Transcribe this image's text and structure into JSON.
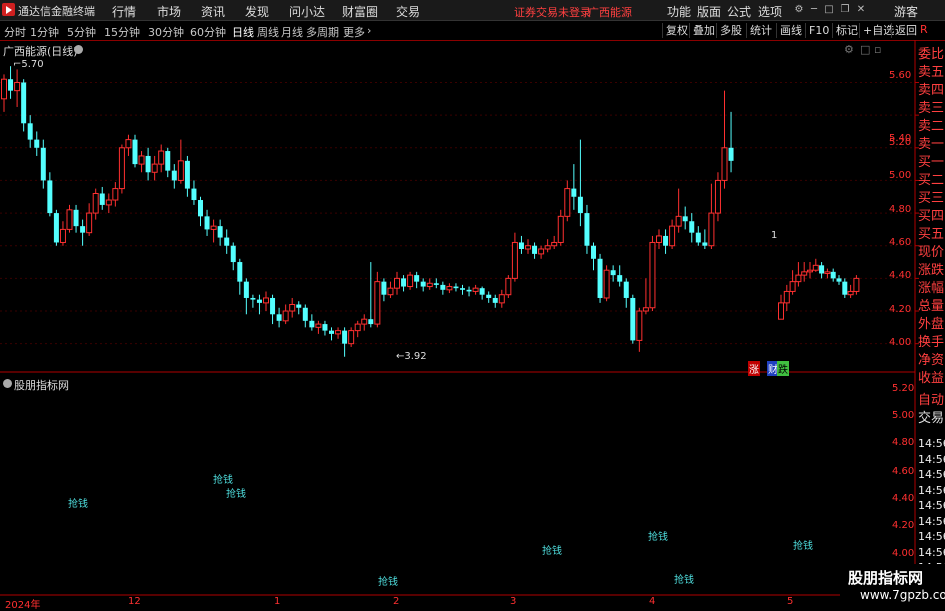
{
  "app": {
    "title": "通达信金融终端"
  },
  "menu": [
    "行情",
    "市场",
    "资讯",
    "发现",
    "问小达",
    "财富圈",
    "交易"
  ],
  "warning": "证券交易未登录",
  "stock_tag": "广西能源",
  "right_menu": [
    "功能",
    "版面",
    "公式",
    "选项"
  ],
  "guest": "游客",
  "periods": [
    "分时",
    "1分钟",
    "5分钟",
    "15分钟",
    "30分钟",
    "60分钟",
    "日线",
    "周线",
    "月线",
    "多周期",
    "更多"
  ],
  "active_period": "日线",
  "tools": [
    "复权",
    "叠加",
    "多股",
    "统计",
    "画线",
    "F10",
    "标记",
    "+自选",
    "返回"
  ],
  "r_badge": "R",
  "chart_header": {
    "name": "广西能源(日线)"
  },
  "price_axis": [
    "5.60",
    "5.40",
    "5.20",
    "5.00",
    "4.80",
    "4.60",
    "4.40",
    "4.20",
    "4.00"
  ],
  "sub_axis": [
    "5.20",
    "5.00",
    "4.80",
    "4.60",
    "4.40",
    "4.20",
    "4.00"
  ],
  "high_label": "5.70",
  "low_label": "3.92",
  "right_panel": [
    "委比",
    "卖五",
    "卖四",
    "卖三",
    "卖二",
    "卖一",
    "买一",
    "买二",
    "买三",
    "买四",
    "买五",
    "现价",
    "涨跌",
    "涨幅",
    "总量",
    "外盘",
    "换手",
    "净资",
    "收益"
  ],
  "right_panel_bottom": [
    "自动",
    "交易"
  ],
  "times": [
    "14:56",
    "14:56",
    "14:56",
    "14:56",
    "14:56",
    "14:56",
    "14:56",
    "14:56",
    "14:56",
    "14:56"
  ],
  "indicator": {
    "name": "股朋指标网",
    "signal_label": "抢钱"
  },
  "x_axis_labels": [
    "2024年",
    "12",
    "1",
    "2",
    "3",
    "4",
    "5"
  ],
  "badges": {
    "zhang": "涨",
    "cai": "财",
    "die": "跌"
  },
  "marker_one": "1",
  "watermark": {
    "line1": "股朋指标网",
    "line2": "www.7gpzb.com"
  },
  "colors": {
    "up": "#ff3030",
    "down": "#54ffff",
    "background": "#000000"
  },
  "chart_data": {
    "type": "candlestick",
    "ylim": [
      3.9,
      5.75
    ],
    "candles": [
      [
        5.5,
        5.62,
        5.42,
        5.65
      ],
      [
        5.62,
        5.55,
        5.5,
        5.7
      ],
      [
        5.55,
        5.6,
        5.45,
        5.68
      ],
      [
        5.6,
        5.35,
        5.3,
        5.62
      ],
      [
        5.35,
        5.25,
        5.2,
        5.4
      ],
      [
        5.25,
        5.2,
        5.15,
        5.3
      ],
      [
        5.2,
        5.0,
        4.95,
        5.25
      ],
      [
        5.0,
        4.8,
        4.78,
        5.05
      ],
      [
        4.8,
        4.62,
        4.6,
        4.82
      ],
      [
        4.62,
        4.7,
        4.6,
        4.75
      ],
      [
        4.7,
        4.82,
        4.68,
        4.85
      ],
      [
        4.82,
        4.72,
        4.68,
        4.85
      ],
      [
        4.72,
        4.68,
        4.6,
        4.76
      ],
      [
        4.68,
        4.8,
        4.66,
        4.86
      ],
      [
        4.8,
        4.92,
        4.76,
        4.95
      ],
      [
        4.92,
        4.85,
        4.82,
        4.96
      ],
      [
        4.85,
        4.88,
        4.8,
        4.92
      ],
      [
        4.88,
        4.95,
        4.84,
        4.99
      ],
      [
        4.95,
        5.2,
        4.92,
        5.22
      ],
      [
        5.2,
        5.25,
        5.15,
        5.28
      ],
      [
        5.25,
        5.1,
        5.08,
        5.28
      ],
      [
        5.1,
        5.15,
        5.05,
        5.18
      ],
      [
        5.15,
        5.05,
        5.0,
        5.2
      ],
      [
        5.05,
        5.1,
        5.0,
        5.15
      ],
      [
        5.1,
        5.18,
        5.05,
        5.22
      ],
      [
        5.18,
        5.06,
        5.02,
        5.2
      ],
      [
        5.06,
        5.0,
        4.95,
        5.1
      ],
      [
        5.0,
        5.12,
        4.98,
        5.25
      ],
      [
        5.12,
        4.95,
        4.9,
        5.15
      ],
      [
        4.95,
        4.88,
        4.85,
        5.0
      ],
      [
        4.88,
        4.78,
        4.72,
        4.9
      ],
      [
        4.78,
        4.7,
        4.66,
        4.82
      ],
      [
        4.7,
        4.72,
        4.62,
        4.76
      ],
      [
        4.72,
        4.65,
        4.6,
        4.76
      ],
      [
        4.65,
        4.6,
        4.55,
        4.7
      ],
      [
        4.6,
        4.5,
        4.45,
        4.62
      ],
      [
        4.5,
        4.38,
        4.3,
        4.52
      ],
      [
        4.38,
        4.28,
        4.18,
        4.4
      ],
      [
        4.28,
        4.27,
        4.22,
        4.3
      ],
      [
        4.27,
        4.25,
        4.18,
        4.3
      ],
      [
        4.25,
        4.28,
        4.2,
        4.32
      ],
      [
        4.28,
        4.18,
        4.12,
        4.3
      ],
      [
        4.18,
        4.14,
        4.1,
        4.22
      ],
      [
        4.14,
        4.2,
        4.12,
        4.24
      ],
      [
        4.2,
        4.24,
        4.16,
        4.28
      ],
      [
        4.24,
        4.22,
        4.18,
        4.26
      ],
      [
        4.22,
        4.14,
        4.1,
        4.24
      ],
      [
        4.14,
        4.1,
        4.08,
        4.18
      ],
      [
        4.1,
        4.12,
        4.06,
        4.14
      ],
      [
        4.12,
        4.08,
        4.05,
        4.14
      ],
      [
        4.08,
        4.06,
        4.02,
        4.1
      ],
      [
        4.06,
        4.08,
        4.03,
        4.1
      ],
      [
        4.08,
        4.0,
        3.92,
        4.1
      ],
      [
        4.0,
        4.08,
        3.98,
        4.1
      ],
      [
        4.08,
        4.12,
        4.04,
        4.14
      ],
      [
        4.12,
        4.15,
        4.08,
        4.18
      ],
      [
        4.15,
        4.12,
        4.1,
        4.5
      ],
      [
        4.12,
        4.38,
        4.1,
        4.44
      ],
      [
        4.38,
        4.3,
        4.26,
        4.4
      ],
      [
        4.3,
        4.34,
        4.28,
        4.38
      ],
      [
        4.34,
        4.4,
        4.3,
        4.44
      ],
      [
        4.4,
        4.35,
        4.32,
        4.42
      ],
      [
        4.35,
        4.42,
        4.33,
        4.44
      ],
      [
        4.42,
        4.38,
        4.34,
        4.44
      ],
      [
        4.38,
        4.35,
        4.32,
        4.4
      ],
      [
        4.35,
        4.37,
        4.33,
        4.4
      ],
      [
        4.37,
        4.36,
        4.34,
        4.4
      ],
      [
        4.36,
        4.33,
        4.3,
        4.38
      ],
      [
        4.33,
        4.35,
        4.31,
        4.37
      ],
      [
        4.35,
        4.34,
        4.32,
        4.37
      ],
      [
        4.34,
        4.33,
        4.3,
        4.36
      ],
      [
        4.33,
        4.32,
        4.29,
        4.35
      ],
      [
        4.32,
        4.34,
        4.3,
        4.36
      ],
      [
        4.34,
        4.3,
        4.27,
        4.35
      ],
      [
        4.3,
        4.28,
        4.25,
        4.32
      ],
      [
        4.28,
        4.25,
        4.22,
        4.3
      ],
      [
        4.25,
        4.3,
        4.22,
        4.33
      ],
      [
        4.3,
        4.4,
        4.28,
        4.42
      ],
      [
        4.4,
        4.62,
        4.38,
        4.68
      ],
      [
        4.62,
        4.58,
        4.55,
        4.66
      ],
      [
        4.58,
        4.6,
        4.55,
        4.64
      ],
      [
        4.6,
        4.55,
        4.52,
        4.62
      ],
      [
        4.55,
        4.58,
        4.52,
        4.6
      ],
      [
        4.58,
        4.6,
        4.56,
        4.64
      ],
      [
        4.6,
        4.62,
        4.58,
        4.66
      ],
      [
        4.62,
        4.78,
        4.6,
        4.82
      ],
      [
        4.78,
        4.95,
        4.75,
        5.0
      ],
      [
        4.95,
        4.9,
        4.82,
        5.1
      ],
      [
        4.9,
        4.8,
        4.72,
        5.25
      ],
      [
        4.8,
        4.6,
        4.55,
        4.85
      ],
      [
        4.6,
        4.52,
        4.45,
        4.62
      ],
      [
        4.52,
        4.28,
        4.25,
        4.55
      ],
      [
        4.28,
        4.45,
        4.26,
        4.48
      ],
      [
        4.45,
        4.42,
        4.38,
        4.48
      ],
      [
        4.42,
        4.38,
        4.35,
        4.48
      ],
      [
        4.38,
        4.28,
        4.22,
        4.4
      ],
      [
        4.28,
        4.02,
        4.0,
        4.3
      ],
      [
        4.02,
        4.2,
        3.95,
        4.22
      ],
      [
        4.2,
        4.22,
        4.18,
        4.4
      ],
      [
        4.22,
        4.62,
        4.2,
        4.66
      ],
      [
        4.62,
        4.66,
        4.58,
        4.7
      ],
      [
        4.66,
        4.6,
        4.55,
        4.7
      ],
      [
        4.6,
        4.72,
        4.58,
        4.76
      ],
      [
        4.72,
        4.78,
        4.68,
        4.95
      ],
      [
        4.78,
        4.75,
        4.7,
        4.84
      ],
      [
        4.75,
        4.68,
        4.62,
        4.8
      ],
      [
        4.68,
        4.62,
        4.6,
        4.72
      ],
      [
        4.62,
        4.6,
        4.58,
        4.7
      ],
      [
        4.6,
        4.8,
        4.58,
        4.98
      ],
      [
        4.8,
        5.0,
        4.75,
        5.05
      ],
      [
        5.0,
        5.2,
        4.95,
        5.55
      ],
      [
        5.2,
        5.12,
        5.05,
        5.42
      ]
    ],
    "candles2": [
      [
        4.15,
        4.25,
        4.15,
        4.3
      ],
      [
        4.25,
        4.32,
        4.2,
        4.36
      ],
      [
        4.32,
        4.38,
        4.3,
        4.45
      ],
      [
        4.38,
        4.42,
        4.35,
        4.5
      ],
      [
        4.42,
        4.44,
        4.38,
        4.5
      ],
      [
        4.44,
        4.45,
        4.4,
        4.5
      ],
      [
        4.45,
        4.48,
        4.44,
        4.52
      ],
      [
        4.48,
        4.43,
        4.4,
        4.5
      ],
      [
        4.43,
        4.44,
        4.4,
        4.46
      ],
      [
        4.44,
        4.4,
        4.38,
        4.46
      ],
      [
        4.4,
        4.38,
        4.36,
        4.42
      ],
      [
        4.38,
        4.3,
        4.28,
        4.4
      ],
      [
        4.3,
        4.32,
        4.28,
        4.36
      ],
      [
        4.32,
        4.4,
        4.3,
        4.42
      ]
    ],
    "signals": [
      [
        4.44,
        "抢钱"
      ],
      [
        4.62,
        "抢钱"
      ],
      [
        4.54,
        "抢钱"
      ],
      [
        3.88,
        "抢钱"
      ],
      [
        4.04,
        "抢钱"
      ],
      [
        4.14,
        "抢钱"
      ],
      [
        3.88,
        "抢钱"
      ],
      [
        4.08,
        "抢钱"
      ]
    ]
  }
}
